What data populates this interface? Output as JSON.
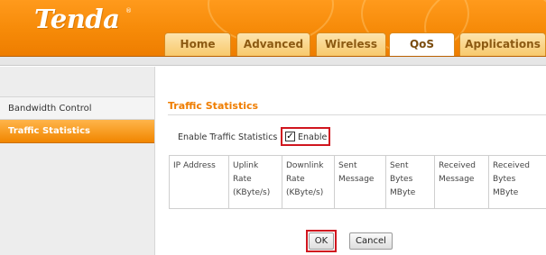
{
  "header": {
    "logo": "Tenda",
    "logo_mark": "®"
  },
  "tabs": [
    {
      "label": "Home",
      "active": false
    },
    {
      "label": "Advanced",
      "active": false
    },
    {
      "label": "Wireless",
      "active": false
    },
    {
      "label": "QoS",
      "active": true
    },
    {
      "label": "Applications",
      "active": false
    }
  ],
  "sidebar": {
    "items": [
      {
        "label": "Bandwidth Control",
        "active": false
      },
      {
        "label": "Traffic Statistics",
        "active": true
      }
    ]
  },
  "main": {
    "section_title": "Traffic Statistics",
    "enable_row_label": "Enable Traffic Statistics",
    "enable_checkbox": {
      "checked": true,
      "label": "Enable"
    },
    "table": {
      "headers": [
        [
          "IP Address"
        ],
        [
          "Uplink",
          "Rate",
          "(KByte/s)"
        ],
        [
          "Downlink",
          "Rate",
          "(KByte/s)"
        ],
        [
          "Sent",
          "Message"
        ],
        [
          "Sent",
          "Bytes",
          "MByte"
        ],
        [
          "Received",
          "Message"
        ],
        [
          "Received",
          "Bytes",
          "MByte"
        ]
      ]
    },
    "buttons": {
      "ok": "OK",
      "cancel": "Cancel"
    }
  },
  "colors": {
    "header_orange": "#f68a08",
    "accent_orange": "#ef7d00",
    "highlight_red": "#d0161f"
  }
}
